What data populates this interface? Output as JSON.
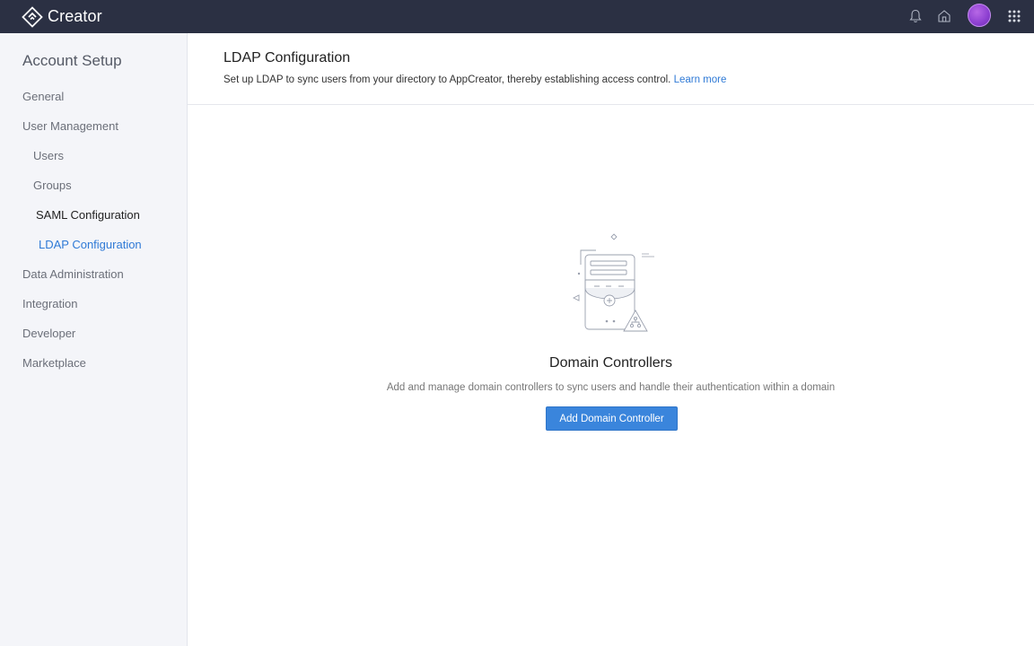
{
  "app": {
    "name": "Creator",
    "logo_icon": "creator-logo-icon"
  },
  "topbar": {
    "icons": [
      "bell-icon",
      "home-icon",
      "avatar",
      "apps-grid-icon"
    ]
  },
  "sidebar": {
    "title": "Account Setup",
    "items": [
      {
        "label": "General"
      },
      {
        "label": "User Management"
      },
      {
        "label": "Users"
      },
      {
        "label": "Groups"
      },
      {
        "label": "SAML Configuration"
      },
      {
        "label": "LDAP Configuration",
        "active": true
      },
      {
        "label": "Data Administration"
      },
      {
        "label": "Integration"
      },
      {
        "label": "Developer"
      },
      {
        "label": "Marketplace"
      }
    ]
  },
  "page": {
    "title": "LDAP Configuration",
    "description": "Set up LDAP to sync users from your directory to AppCreator, thereby establishing access control.",
    "learn_more": "Learn more"
  },
  "empty_state": {
    "title": "Domain Controllers",
    "description": "Add and manage domain controllers to sync users and handle their authentication within a domain",
    "button": "Add Domain Controller",
    "illustration_icon": "domain-controller-illustration-icon"
  },
  "colors": {
    "topbar": "#2b3043",
    "sidebar": "#f4f5f9",
    "accent": "#2f7ad6",
    "button": "#3a85dc"
  }
}
